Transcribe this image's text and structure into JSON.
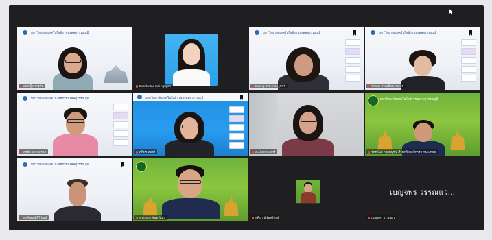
{
  "meeting": {
    "banner_text": "มหาวิทยาลัยเทคโนโลยีราชมงคลสุวรรณภูมิ",
    "green_banner_text": "มหาวิทยาลัยเทคโนโลยีราชมงคลสุวรรณภูมิ",
    "active_speaker_label": "เบญจพร วรรณแว...",
    "tiles": [
      {
        "name": "สมหญิง จารุทัต"
      },
      {
        "name": "Daeduntae Hai nguyen"
      },
      {
        "name": "Daeng 372 JANI_RTT"
      },
      {
        "name": "วาสนา วาดเขียน RMUT"
      },
      {
        "name": "สุรชัย ยาวจุดรอด"
      },
      {
        "name": "ศศิพร ทองดี"
      },
      {
        "name": "ละเอียด ทองศรี"
      },
      {
        "name": "จักรพันธ์ คงสมบูรณ์ สำนักวิทยบริการฯ RMUTSB"
      },
      {
        "name": "พงศ์พัฒน์ ศิริวัฒน์"
      },
      {
        "name": "พรรณภา จันทร์แสง"
      },
      {
        "name": "พศินา มีชัยศรีพงษ์"
      },
      {
        "name": "เบญจพร วรรณแว"
      }
    ]
  },
  "colors": {
    "meeting_bg": "#1f1f21",
    "page_bg": "#e9e9ec",
    "muted_mic": "#e04a3a"
  }
}
